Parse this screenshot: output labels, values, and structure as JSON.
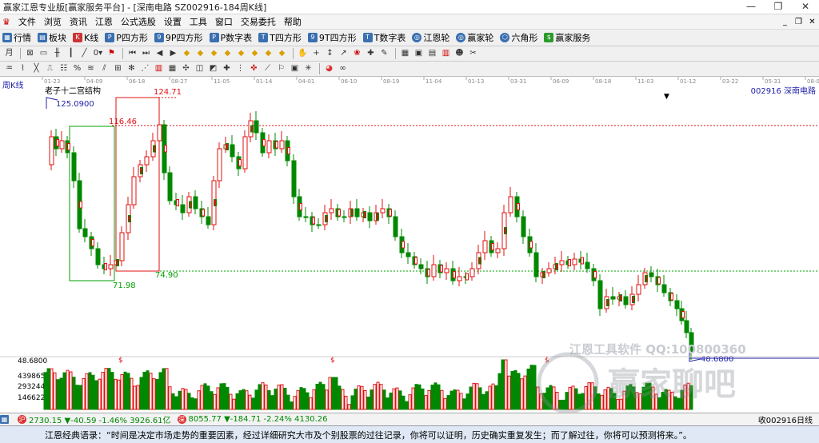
{
  "window": {
    "title": "赢家江恩专业版[赢家服务平台] - [深南电路  SZ002916-184周K线]"
  },
  "menu": [
    "文件",
    "浏览",
    "资讯",
    "江恩",
    "公式选股",
    "设置",
    "工具",
    "窗口",
    "交易委托",
    "帮助"
  ],
  "toolbar1": [
    "行情",
    "板块",
    "K线",
    "P四方形",
    "9P四方形",
    "P数字表",
    "T四方形",
    "9T四方形",
    "T数字表",
    "江恩轮",
    "赢家轮",
    "六角形",
    "赢家服务"
  ],
  "chart": {
    "period_label": "周K线",
    "stock_label": "002916  深南电路",
    "indicator_label": "老子十二宫结构",
    "x_dates": [
      "01-23",
      "04-09",
      "06-18",
      "08-27",
      "11-05",
      "01-14",
      "04-01",
      "06-10",
      "08-19",
      "11-04",
      "01-13",
      "03-31",
      "06-09",
      "08-18",
      "11-03",
      "01-12",
      "03-22",
      "05-31",
      "08-09"
    ],
    "price_labels": {
      "high": "125.0900",
      "box_high": "124.71",
      "box_mid": "116.46",
      "box_low_left": "71.98",
      "box_low_right": "74.90",
      "last_low": "48.6800"
    },
    "volume_axis": [
      "48.6800",
      "439865",
      "293244",
      "146622"
    ],
    "watermark": "江恩工具软件  QQ:100800360",
    "logo_text": "赢家聊吧",
    "colors": {
      "up": "#e01010",
      "down": "#008800",
      "dash_red": "#e01010",
      "dash_green": "#00a000",
      "box_red": "#e01010",
      "box_green": "#00a000"
    }
  },
  "statusbar": {
    "sh_badge": "沪",
    "sh_text": "2730.15 ▼-40.59 -1.46% 3926.61亿",
    "sz_badge": "深",
    "sz_text": "8055.77 ▼-184.71 -2.24% 4130.26",
    "right_text": "收002916日线"
  },
  "quote": {
    "text": "江恩经典语录：“时间是决定市场走势的重要因素，经过详细研究大市及个别股票的过往记录，你将可以证明，历史确实重复发生；而了解过往，你将可以预测将来。”。"
  }
}
